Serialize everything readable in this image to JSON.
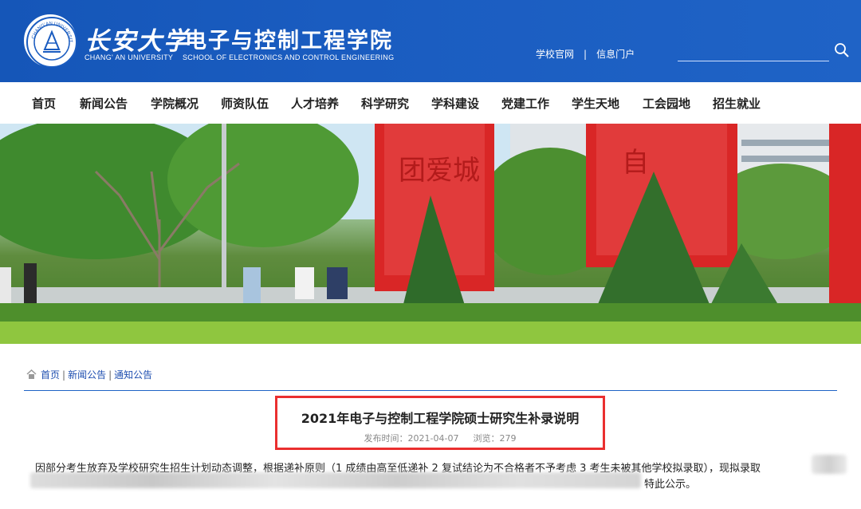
{
  "header": {
    "seal_text": "CHANG'AN UNIVERSITY",
    "university_cn": "长安大学",
    "school_cn": "电子与控制工程学院",
    "university_en": "CHANG' AN UNIVERSITY",
    "school_en": "SCHOOL OF ELECTRONICS AND CONTROL ENGINEERING",
    "links": [
      "学校官网",
      "信息门户"
    ],
    "link_separator": "|",
    "search_placeholder": ""
  },
  "nav": {
    "items": [
      "首页",
      "新闻公告",
      "学院概况",
      "师资队伍",
      "人才培养",
      "科学研究",
      "学科建设",
      "党建工作",
      "学生天地",
      "工会园地",
      "招生就业"
    ]
  },
  "banner": {
    "sign_chars_left": "团爱城",
    "sign_chars_right": "自"
  },
  "breadcrumb": {
    "items": [
      "首页",
      "新闻公告",
      "通知公告"
    ],
    "separator": "|"
  },
  "article": {
    "title": "2021年电子与控制工程学院硕士研究生补录说明",
    "publish_label": "发布时间：2021-04-07",
    "views_label": "浏览：279",
    "paragraph_line1": "因部分考生放弃及学校研究生招生计划动态调整，根据递补原则（1 成绩由高至低递补 2 复试结论为不合格者不予考虑 3 考生未被其他学校拟录取），现拟录取",
    "paragraph_end": "特此公示。"
  },
  "colors": {
    "header_blue": "#1a5cc0",
    "highlight_red": "#ea2f2f",
    "link_blue": "#1f4fb0"
  }
}
